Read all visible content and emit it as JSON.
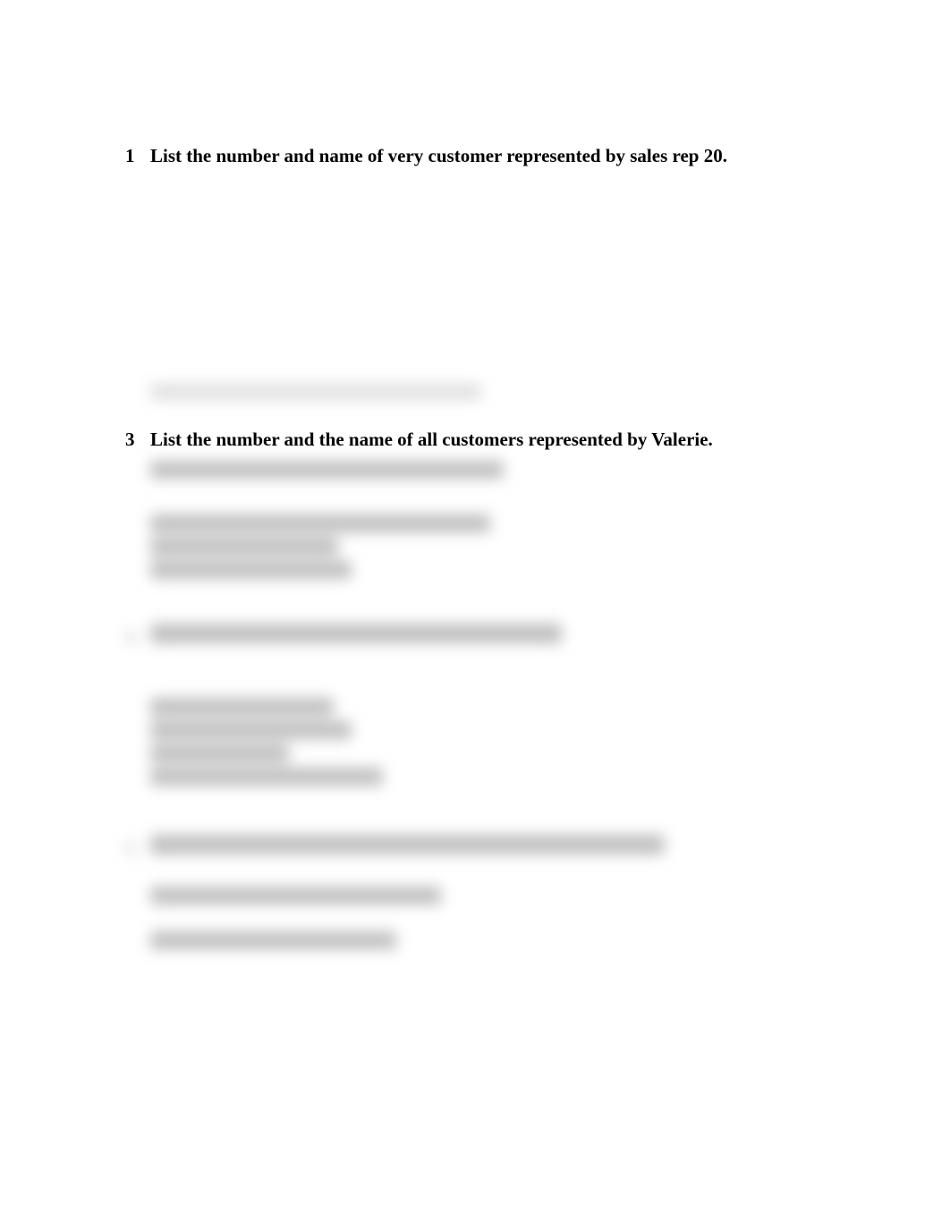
{
  "questions": {
    "q1": {
      "number": "1",
      "text": "List the number and name of very customer represented by sales rep 20."
    },
    "q3": {
      "number": "3",
      "text": "List the number and the name of all customers represented by Valerie."
    }
  }
}
